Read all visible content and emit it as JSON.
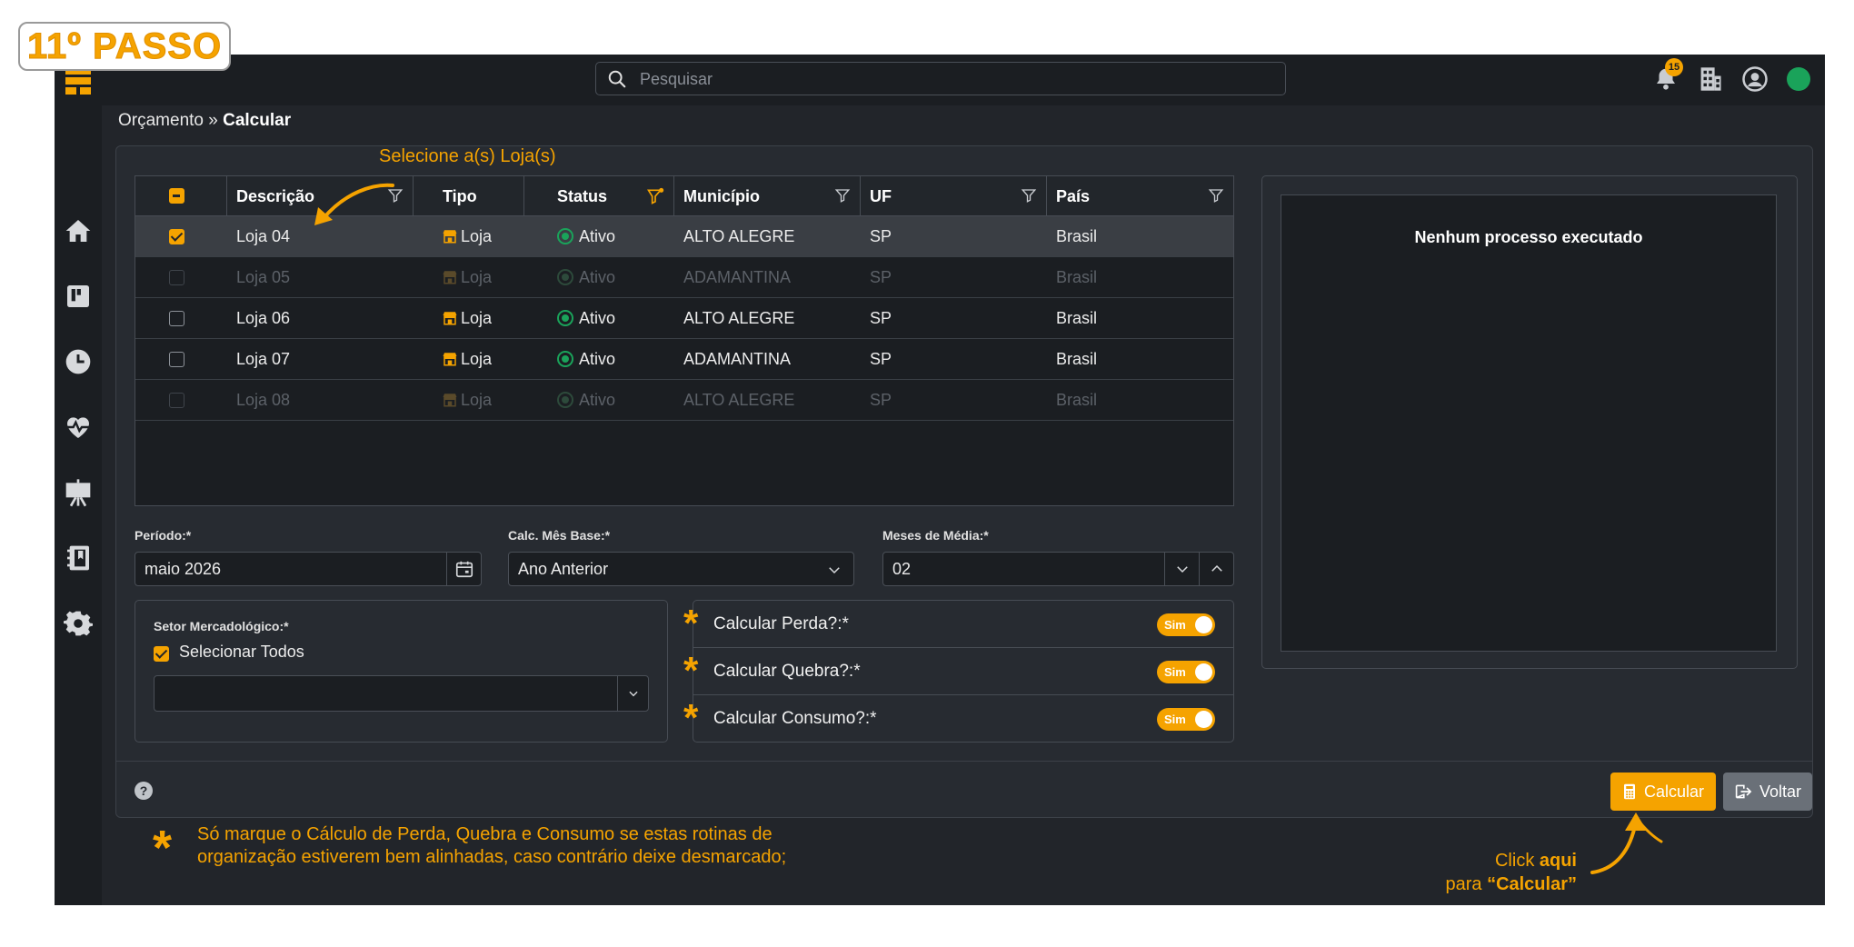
{
  "step_badge": "11º PASSO",
  "search": {
    "placeholder": "Pesquisar"
  },
  "notifications": {
    "count": "15"
  },
  "breadcrumb": {
    "parent": "Orçamento",
    "separator": " » ",
    "current": "Calcular"
  },
  "annotations": {
    "select_stores": "Selecione a(s) Loja(s)",
    "note_line1": "Só marque o Cálculo de Perda, Quebra e Consumo se estas rotinas de",
    "note_line2": "organização estiverem bem alinhadas, caso contrário deixe desmarcado;",
    "click_prefix": "Click ",
    "click_here": "aqui",
    "click_for": "para ",
    "click_target": "“Calcular”",
    "star": "*"
  },
  "table": {
    "columns": [
      "Descrição",
      "Tipo",
      "Status",
      "Município",
      "UF",
      "País"
    ],
    "rows": [
      {
        "descricao": "Loja 04",
        "tipo": "Loja",
        "status": "Ativo",
        "municipio": "ALTO ALEGRE",
        "uf": "SP",
        "pais": "Brasil",
        "checked": true,
        "disabled": false
      },
      {
        "descricao": "Loja 05",
        "tipo": "Loja",
        "status": "Ativo",
        "municipio": "ADAMANTINA",
        "uf": "SP",
        "pais": "Brasil",
        "checked": false,
        "disabled": true
      },
      {
        "descricao": "Loja 06",
        "tipo": "Loja",
        "status": "Ativo",
        "municipio": "ALTO ALEGRE",
        "uf": "SP",
        "pais": "Brasil",
        "checked": false,
        "disabled": false
      },
      {
        "descricao": "Loja 07",
        "tipo": "Loja",
        "status": "Ativo",
        "municipio": "ADAMANTINA",
        "uf": "SP",
        "pais": "Brasil",
        "checked": false,
        "disabled": false
      },
      {
        "descricao": "Loja 08",
        "tipo": "Loja",
        "status": "Ativo",
        "municipio": "ALTO ALEGRE",
        "uf": "SP",
        "pais": "Brasil",
        "checked": false,
        "disabled": true
      }
    ]
  },
  "form": {
    "periodo": {
      "label": "Período:*",
      "value": "maio 2026"
    },
    "calc_mes_base": {
      "label": "Calc. Mês Base:*",
      "value": "Ano Anterior"
    },
    "meses_media": {
      "label": "Meses de Média:*",
      "value": "02"
    },
    "setor": {
      "label": "Setor Mercadológico:*",
      "select_all": "Selecionar Todos",
      "select_all_checked": true,
      "value": ""
    },
    "toggles": [
      {
        "label": "Calcular Perda?:*",
        "state": "Sim"
      },
      {
        "label": "Calcular Quebra?:*",
        "state": "Sim"
      },
      {
        "label": "Calcular Consumo?:*",
        "state": "Sim"
      }
    ]
  },
  "process_panel": {
    "message": "Nenhum processo executado"
  },
  "footer": {
    "help": "?",
    "calc_button": "Calcular",
    "back_button": "Voltar"
  },
  "colors": {
    "accent": "#f5a300",
    "background": "#22252a",
    "success": "#1aa35a",
    "secondary_button": "#6a7078"
  }
}
